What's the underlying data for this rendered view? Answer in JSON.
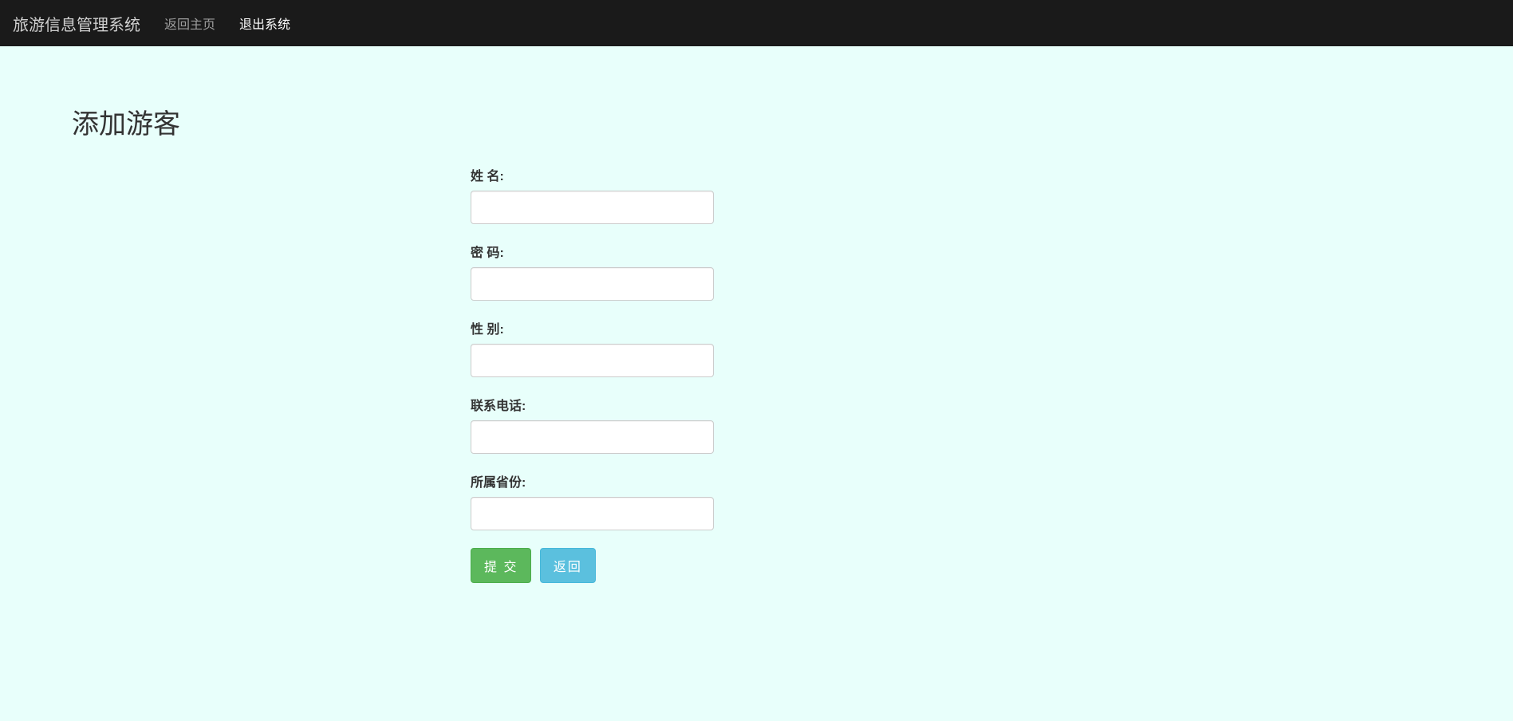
{
  "navbar": {
    "brand": "旅游信息管理系统",
    "home_link": "返回主页",
    "logout_link": "退出系统"
  },
  "page": {
    "title": "添加游客"
  },
  "form": {
    "name_label": "姓   名:",
    "name_value": "",
    "password_label": "密   码:",
    "password_value": "",
    "gender_label": "性   别:",
    "gender_value": "",
    "phone_label": "联系电话:",
    "phone_value": "",
    "province_label": "所属省份:",
    "province_value": "",
    "submit_label": "提 交",
    "back_label": "返回"
  }
}
